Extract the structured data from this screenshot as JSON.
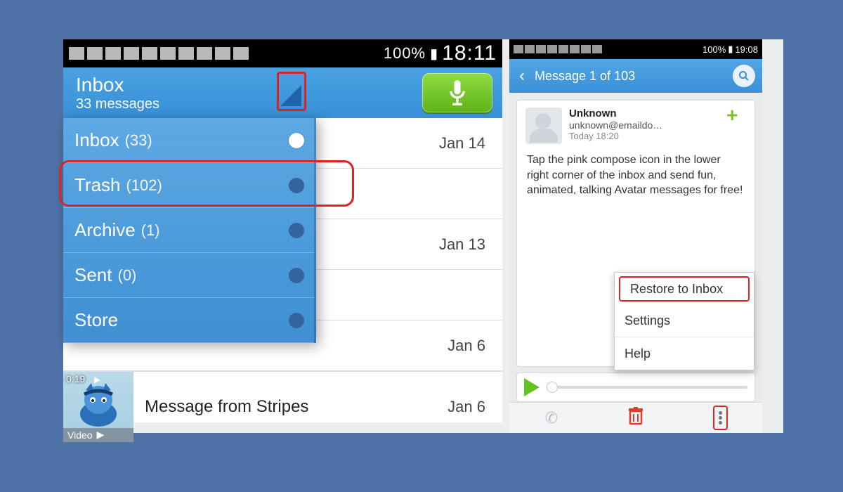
{
  "left": {
    "status": {
      "battery_pct": "100%",
      "time": "18:11"
    },
    "appbar": {
      "title": "Inbox",
      "subtitle": "33 messages"
    },
    "folders": {
      "inbox": {
        "label": "Inbox",
        "count": "(33)"
      },
      "trash": {
        "label": "Trash",
        "count": "(102)"
      },
      "archive": {
        "label": "Archive",
        "count": "(1)"
      },
      "sent": {
        "label": "Sent",
        "count": "(0)"
      },
      "store": {
        "label": "Store"
      }
    },
    "list": {
      "r1_date": "Jan 14",
      "r3_date": "Jan 13",
      "r5_date": "Jan 6",
      "video": {
        "duration": "0:19",
        "badge": "Video",
        "subject": "Message from Stripes",
        "date": "Jan 6"
      }
    }
  },
  "right": {
    "status": {
      "battery_pct": "100%",
      "time": "19:08"
    },
    "appbar": {
      "title": "Message 1 of 103"
    },
    "sender": {
      "name": "Unknown",
      "email": "unknown@emaildo…",
      "when": "Today 18:20"
    },
    "body": "Tap the pink compose icon in the lower right corner of the inbox and send fun, animated, talking Avatar messages for free!",
    "menu": {
      "restore": "Restore to Inbox",
      "settings": "Settings",
      "help": "Help"
    }
  }
}
